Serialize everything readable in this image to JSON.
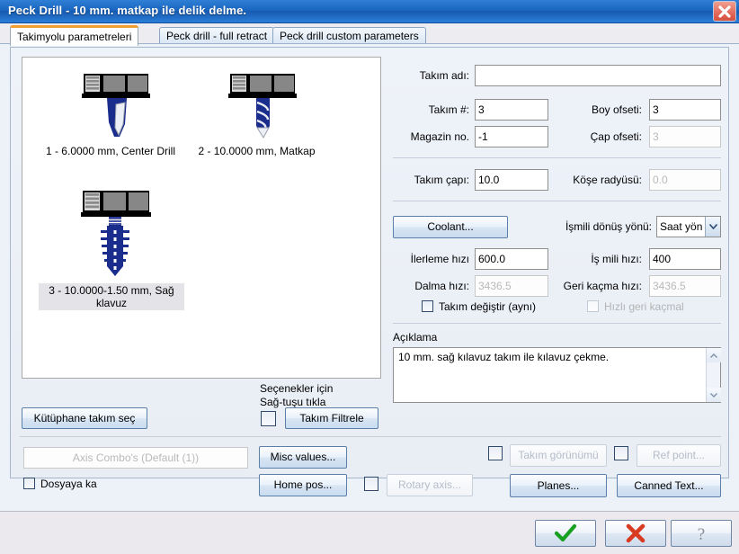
{
  "window": {
    "title": "Peck Drill - 10 mm. matkap ile delik delme.",
    "close_icon": "close-icon"
  },
  "tabs": [
    {
      "label": "Takimyolu parametreleri",
      "active": true
    },
    {
      "label": "Peck drill - full retract",
      "active": false
    },
    {
      "label": "Peck drill custom parameters",
      "active": false
    }
  ],
  "tool_list": {
    "items": [
      {
        "label": "1 - 6.0000 mm, Center Drill",
        "icon": "center-drill-icon",
        "selected": false
      },
      {
        "label": "2 - 10.0000 mm, Matkap",
        "icon": "drill-icon",
        "selected": false
      },
      {
        "label": "3 - 10.0000-1.50 mm, Sağ klavuz",
        "icon": "tap-icon",
        "selected": true
      }
    ]
  },
  "left_controls": {
    "library_button": "Kütüphane takım seç",
    "options_hint_line1": "Seçenekler için",
    "options_hint_line2": "Sağ-tuşu tıkla",
    "filter_checkbox_checked": false,
    "filter_button": "Takım Filtrele"
  },
  "tool_form": {
    "tool_name_label": "Takım adı:",
    "tool_name_value": "",
    "tool_number_label": "Takım #:",
    "tool_number_value": "3",
    "length_offset_label": "Boy ofseti:",
    "length_offset_value": "3",
    "magazine_label": "Magazin no.",
    "magazine_value": "-1",
    "diameter_offset_label": "Çap ofseti:",
    "diameter_offset_value": "3",
    "diameter_offset_disabled": true,
    "tool_diameter_label": "Takım çapı:",
    "tool_diameter_value": "10.0",
    "corner_radius_label": "Köşe radyüsü:",
    "corner_radius_value": "0.0",
    "corner_radius_disabled": true
  },
  "spindle": {
    "coolant_button": "Coolant...",
    "rotation_label": "İşmili dönüş yönü:",
    "rotation_value": "Saat yön",
    "feed_label": "İlerleme hızı",
    "feed_value": "600.0",
    "spindle_speed_label": "İş mili hızı:",
    "spindle_speed_value": "400",
    "plunge_label": "Dalma hızı:",
    "plunge_value": "3436.5",
    "plunge_disabled": true,
    "retract_label": "Geri kaçma hızı:",
    "retract_value": "3436.5",
    "retract_disabled": true,
    "toolchange_label": "Takım değiştir (aynı)",
    "toolchange_checked": false,
    "rapid_retract_label": "Hızlı geri kaçmal",
    "rapid_retract_checked": false,
    "rapid_retract_disabled": true
  },
  "description": {
    "title": "Açıklama",
    "text": "10 mm. sağ kılavuz takım ile kılavuz çekme.",
    "scroll_up_icon": "chevron-up-icon",
    "scroll_down_icon": "chevron-down-icon"
  },
  "bottom_controls": {
    "axis_combo_value": "Axis Combo's (Default (1))",
    "axis_combo_disabled": true,
    "save_to_file_label": "Dosyaya ka",
    "save_to_file_checked": false,
    "misc_values_button": "Misc values...",
    "home_pos_button": "Home pos...",
    "rotary_axis_checkbox_checked": false,
    "rotary_axis_button": "Rotary axis...",
    "rotary_axis_disabled": true,
    "tool_display_checkbox_checked": false,
    "tool_display_button": "Takım görünümü",
    "tool_display_disabled": true,
    "ref_point_checkbox_checked": false,
    "ref_point_button": "Ref point...",
    "ref_point_disabled": true,
    "planes_button": "Planes...",
    "canned_text_button": "Canned Text..."
  },
  "footer": {
    "ok_icon": "checkmark-icon",
    "cancel_icon": "cross-icon",
    "help_icon": "question-mark-icon"
  },
  "colors": {
    "title_bar": "#1a66c0",
    "active_tab_accent": "#f0a030",
    "ok_green": "#18a020",
    "cancel_red": "#d93a22",
    "tool_blue": "#1a2c8c"
  }
}
